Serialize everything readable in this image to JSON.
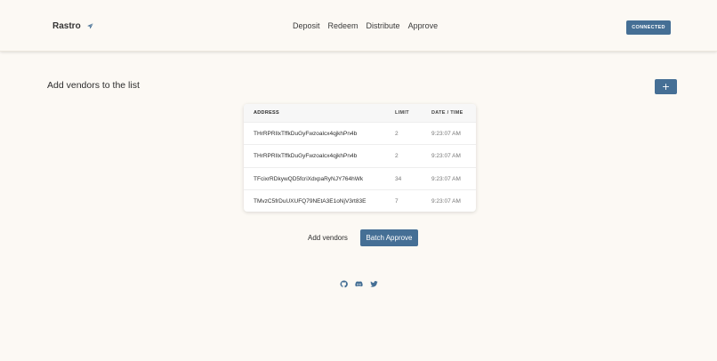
{
  "header": {
    "brand": "Rastro",
    "nav": [
      "Deposit",
      "Redeem",
      "Distribute",
      "Approve"
    ],
    "connected_label": "CONNECTED"
  },
  "main": {
    "title": "Add vendors to the list",
    "add_button_label": "+",
    "table": {
      "columns": [
        "ADDRESS",
        "LIMIT",
        "DATE / TIME"
      ],
      "rows": [
        {
          "address": "THrRPRIlxTffkDuGyFwzoalcx4qjkhPn4b",
          "limit": "2",
          "datetime": "9:23:07 AM"
        },
        {
          "address": "THrRPRIlxTffkDuGyFwzoalcx4qjkhPn4b",
          "limit": "2",
          "datetime": "9:23:07 AM"
        },
        {
          "address": "TFcixrRDkywQD5fcriXdxpaRyNJY764hWk",
          "limit": "34",
          "datetime": "9:23:07 AM"
        },
        {
          "address": "TMvzC5frDuUXUFQ79NEtA3E1oNjV3rt83E",
          "limit": "7",
          "datetime": "9:23:07 AM"
        }
      ]
    },
    "add_vendors_label": "Add vendors",
    "batch_approve_label": "Batch Approve"
  },
  "footer": {
    "icons": [
      "github-icon",
      "discord-icon",
      "twitter-icon"
    ]
  },
  "colors": {
    "background": "#fcf9f4",
    "accent": "#456f95"
  }
}
